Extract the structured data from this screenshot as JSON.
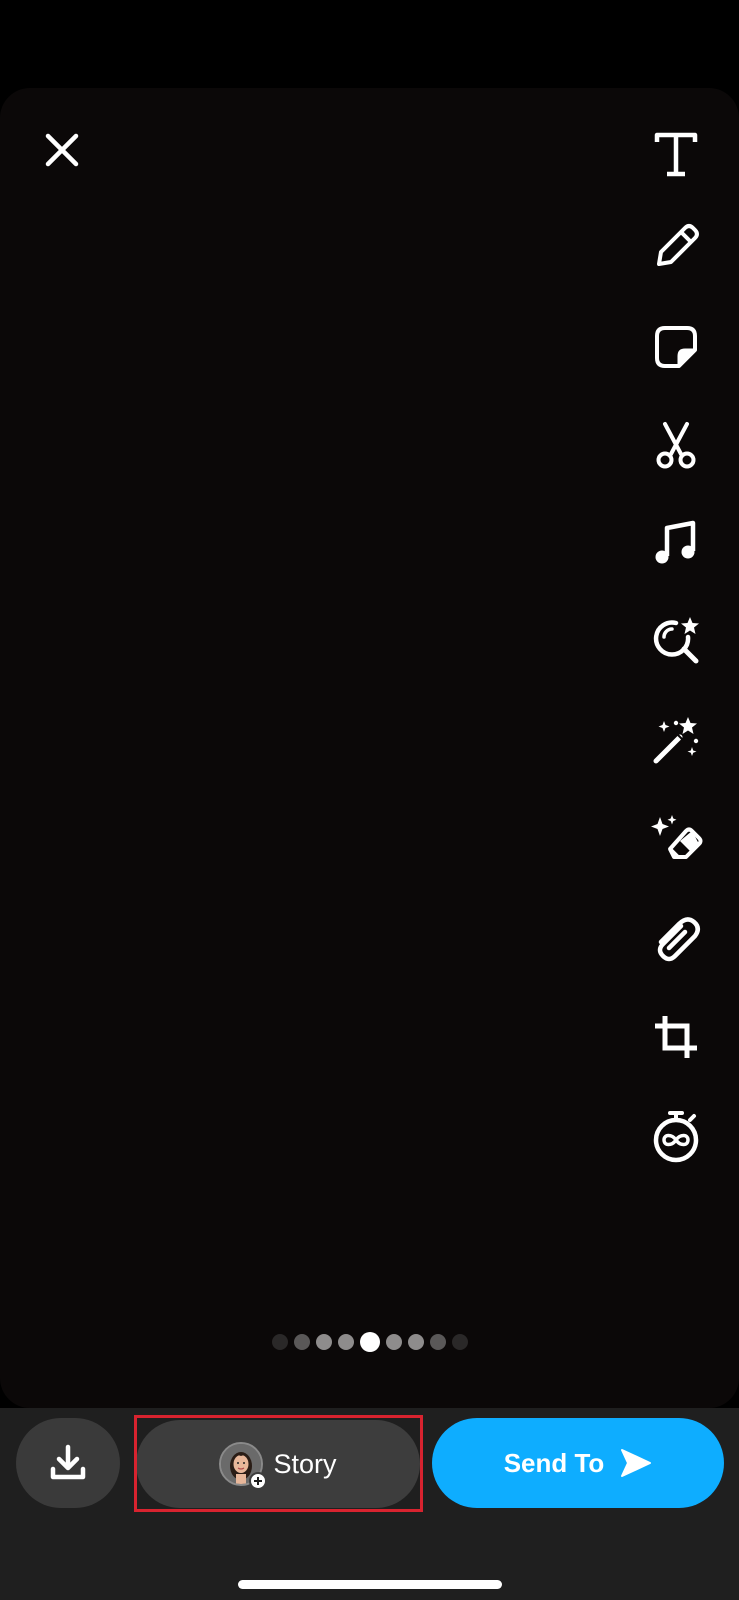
{
  "editor": {
    "close_icon": "close-icon",
    "tools": [
      {
        "name": "text",
        "icon": "text-icon"
      },
      {
        "name": "draw",
        "icon": "pencil-icon"
      },
      {
        "name": "sticker",
        "icon": "sticker-icon"
      },
      {
        "name": "scissors",
        "icon": "scissors-icon"
      },
      {
        "name": "music",
        "icon": "music-note-icon"
      },
      {
        "name": "lens",
        "icon": "lens-search-icon"
      },
      {
        "name": "magic",
        "icon": "magic-wand-icon"
      },
      {
        "name": "eraser",
        "icon": "magic-eraser-icon"
      },
      {
        "name": "attach",
        "icon": "paperclip-icon"
      },
      {
        "name": "crop",
        "icon": "crop-icon"
      },
      {
        "name": "timer",
        "icon": "infinity-timer-icon"
      }
    ],
    "page_indicator": {
      "count": 9,
      "active_index": 4
    }
  },
  "bottom_bar": {
    "save_icon": "download-icon",
    "story_label": "Story",
    "send_label": "Send To",
    "send_icon": "send-arrow-icon"
  },
  "colors": {
    "accent_blue": "#0eadff",
    "highlight_red": "#d8232f",
    "canvas_bg": "#0b0808"
  }
}
